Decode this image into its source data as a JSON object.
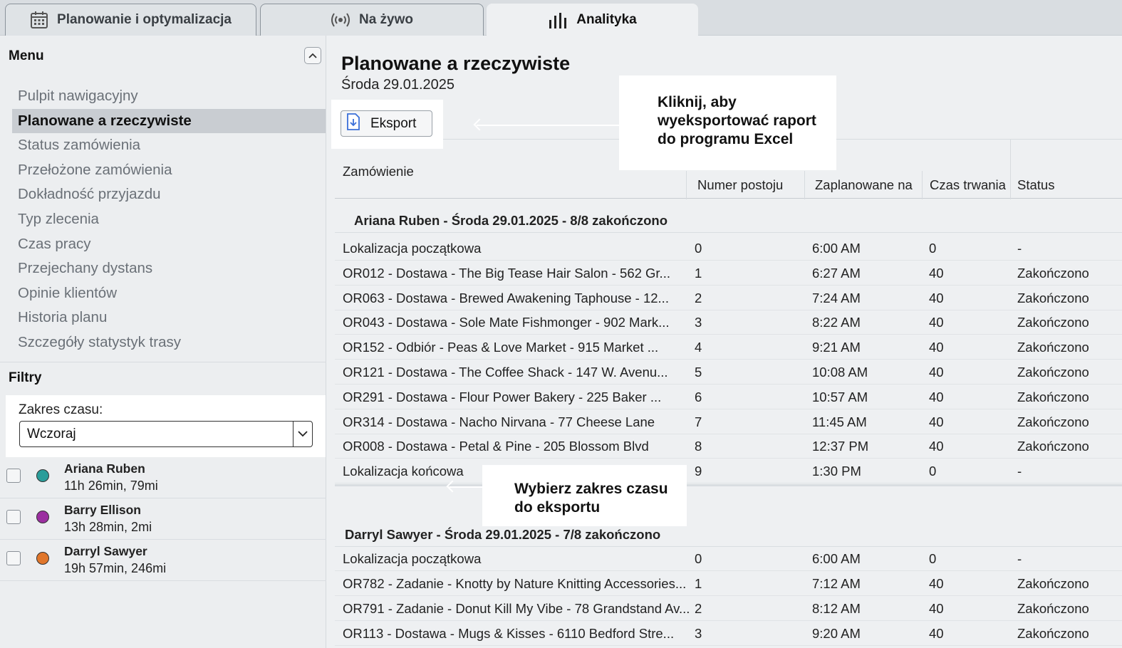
{
  "tabs": [
    {
      "label": "Planowanie i optymalizacja",
      "icon": "calendar-icon",
      "active": false
    },
    {
      "label": "Na żywo",
      "icon": "broadcast-icon",
      "active": false
    },
    {
      "label": "Analityka",
      "icon": "bar-chart-icon",
      "active": true
    }
  ],
  "sidebar": {
    "menu_title": "Menu",
    "items": [
      {
        "label": "Pulpit nawigacyjny"
      },
      {
        "label": "Planowane a rzeczywiste",
        "active": true
      },
      {
        "label": "Status zamówienia"
      },
      {
        "label": "Przełożone zamówienia"
      },
      {
        "label": "Dokładność przyjazdu"
      },
      {
        "label": "Typ zlecenia"
      },
      {
        "label": "Czas pracy"
      },
      {
        "label": "Przejechany dystans"
      },
      {
        "label": "Opinie klientów"
      },
      {
        "label": "Historia planu"
      },
      {
        "label": "Szczegóły statystyk trasy"
      }
    ],
    "filters_title": "Filtry",
    "range_label": "Zakres czasu:",
    "range_value": "Wczoraj",
    "drivers": [
      {
        "name": "Ariana Ruben",
        "stats": "11h 26min, 79mi",
        "color": "#2a9d9a"
      },
      {
        "name": "Barry Ellison",
        "stats": "13h 28min, 2mi",
        "color": "#9b2fa0"
      },
      {
        "name": "Darryl Sawyer",
        "stats": "19h 57min, 246mi",
        "color": "#e0762b"
      }
    ]
  },
  "main": {
    "title": "Planowane a rzeczywiste",
    "date": "Środa 29.01.2025",
    "export_label": "Eksport",
    "callout_export": "Kliknij, aby wyeksportować raport do programu Excel",
    "callout_range": "Wybierz zakres czasu do eksportu",
    "columns": [
      "Zamówienie",
      "Numer postoju",
      "Zaplanowane na",
      "Czas trwania",
      "Status"
    ],
    "groups": [
      {
        "title": "Ariana Ruben - Środa 29.01.2025 - 8/8 zakończono",
        "rows": [
          [
            "Lokalizacja początkowa",
            "0",
            "6:00 AM",
            "0",
            "-"
          ],
          [
            "OR012 - Dostawa - The Big Tease Hair Salon - 562 Gr...",
            "1",
            "6:27 AM",
            "40",
            "Zakończono"
          ],
          [
            "OR063 - Dostawa - Brewed Awakening Taphouse - 12...",
            "2",
            "7:24 AM",
            "40",
            "Zakończono"
          ],
          [
            "OR043 - Dostawa - Sole Mate Fishmonger - 902 Mark...",
            "3",
            "8:22 AM",
            "40",
            "Zakończono"
          ],
          [
            "OR152 - Odbiór - Peas & Love Market - 915 Market ...",
            "4",
            "9:21 AM",
            "40",
            "Zakończono"
          ],
          [
            "OR121 - Dostawa - The Coffee Shack - 147 W. Avenu...",
            "5",
            "10:08 AM",
            "40",
            "Zakończono"
          ],
          [
            "OR291 - Dostawa - Flour Power Bakery - 225 Baker ...",
            "6",
            "10:57 AM",
            "40",
            "Zakończono"
          ],
          [
            "OR314 - Dostawa - Nacho Nirvana - 77 Cheese Lane",
            "7",
            "11:45 AM",
            "40",
            "Zakończono"
          ],
          [
            "OR008 - Dostawa - Petal & Pine - 205 Blossom Blvd",
            "8",
            "12:37 PM",
            "40",
            "Zakończono"
          ],
          [
            "Lokalizacja końcowa",
            "9",
            "1:30 PM",
            "0",
            "-"
          ]
        ]
      },
      {
        "title": "Darryl Sawyer - Środa 29.01.2025 - 7/8 zakończono",
        "rows": [
          [
            "Lokalizacja początkowa",
            "0",
            "6:00 AM",
            "0",
            "-"
          ],
          [
            "OR782 - Zadanie - Knotty by Nature Knitting Accessories...",
            "1",
            "7:12 AM",
            "40",
            "Zakończono"
          ],
          [
            "OR791 - Zadanie - Donut Kill My Vibe - 78 Grandstand Av...",
            "2",
            "8:12 AM",
            "40",
            "Zakończono"
          ],
          [
            "OR113 - Dostawa - Mugs & Kisses - 6110 Bedford Stre...",
            "3",
            "9:20 AM",
            "40",
            "Zakończono"
          ]
        ]
      }
    ]
  }
}
